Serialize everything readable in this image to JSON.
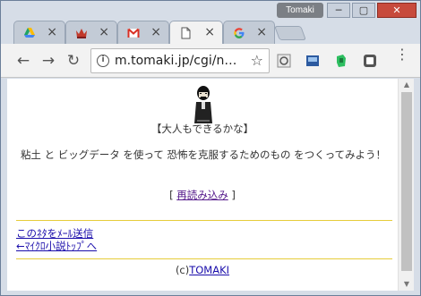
{
  "window": {
    "profile_name": "Tomaki",
    "minimize_glyph": "─",
    "maximize_glyph": "▢",
    "close_glyph": "✕"
  },
  "tabs": [
    {
      "icon": "google-drive-icon",
      "close": "×"
    },
    {
      "icon": "crown-icon",
      "close": "×"
    },
    {
      "icon": "gmail-icon",
      "close": "×"
    },
    {
      "icon": "page-icon",
      "close": "×",
      "active": true
    },
    {
      "icon": "google-icon",
      "close": "×"
    }
  ],
  "toolbar": {
    "back": "←",
    "forward": "→",
    "reload": "↻",
    "info": "i",
    "url": "m.tomaki.jp/cgi/n…",
    "star": "☆",
    "menu": "⋮"
  },
  "page": {
    "heading": "【大人もできるかな】",
    "body": "粘土 と ビッグデータ を使って 恐怖を克服するためのもの をつくってみよう！",
    "reload_open": "[ ",
    "reload_link": "再読み込み",
    "reload_close": " ]",
    "link_mail": "このﾈﾀをﾒｰﾙ送信",
    "link_back": "←ﾏｲｸﾛ小説ﾄｯﾌﾟへ",
    "footer_prefix": "(c)",
    "footer_link": "TOMAKI"
  },
  "colors": {
    "divider": "#e6cc3a",
    "link": "#1a0dab",
    "visited": "#551a8b",
    "close_button": "#c74a3c"
  }
}
